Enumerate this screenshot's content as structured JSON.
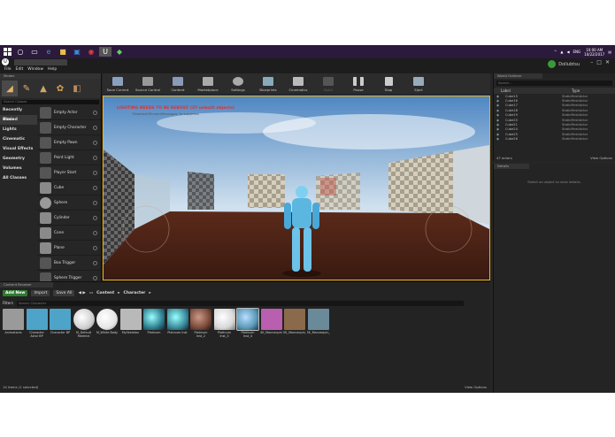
{
  "taskbar": {
    "clock_time": "10:00 AM",
    "clock_date": "10/22/2017",
    "lang": "ENG"
  },
  "ue": {
    "menu": [
      "File",
      "Edit",
      "Window",
      "Help"
    ],
    "user_name": "Dollubtsu"
  },
  "modes": {
    "tab_label": "Modes",
    "search_placeholder": "Search Classes",
    "categories": [
      "Recently Placed",
      "Basic",
      "Lights",
      "Cinematic",
      "Visual Effects",
      "Geometry",
      "Volumes",
      "All Classes"
    ],
    "active_category": "Basic",
    "items": [
      "Empty Actor",
      "Empty Character",
      "Empty Pawn",
      "Point Light",
      "Player Start",
      "Cube",
      "Sphere",
      "Cylinder",
      "Cone",
      "Plane",
      "Box Trigger",
      "Sphere Trigger"
    ]
  },
  "toolbar": {
    "buttons": [
      "Save Current",
      "Source Control",
      "Content",
      "Marketplace",
      "Settings",
      "Blueprints",
      "Cinematics",
      "Build",
      "Pause",
      "Stop",
      "Eject"
    ]
  },
  "viewport": {
    "warning": "LIGHTING NEEDS TO BE REBUILT (37 unbuilt objects)",
    "warning_sub": "'DisableAllScreenMessages' to suppress"
  },
  "content_browser": {
    "tab_label": "Content Browser",
    "add_new": "Add New",
    "import": "Import",
    "save_all": "Save All",
    "path": [
      "Content",
      "Character"
    ],
    "filters": "Filters",
    "search_placeholder": "Search Character",
    "assets": [
      {
        "name": "Animations",
        "color": "#9a9a9a"
      },
      {
        "name": "Character Actor BP",
        "color": "#4ea3c8"
      },
      {
        "name": "Character BP",
        "color": "#4ea3c8"
      },
      {
        "name": "M_Default Material",
        "color": "#cfcfcf"
      },
      {
        "name": "M_White Body",
        "color": "#e5e5e5"
      },
      {
        "name": "MySkeleton",
        "color": "#b9b9b9"
      },
      {
        "name": "Platinum",
        "color": "#2f7f8f"
      },
      {
        "name": "Platinum Inst",
        "color": "#3a8a9a"
      },
      {
        "name": "Platinum Inst_2",
        "color": "#7a4a3a"
      },
      {
        "name": "Platinum Inst_3",
        "color": "#d8d8d8"
      },
      {
        "name": "Platinum Inst_4",
        "color": "#5a9ab8"
      },
      {
        "name": "SK_Mannequin",
        "color": "#b85fb0"
      },
      {
        "name": "SK_Mannequin_PhysicsAsset",
        "color": "#8a6a4a"
      },
      {
        "name": "SK_Mannequin_Skeleton",
        "color": "#6a8a9a"
      }
    ],
    "footer_left": "14 items (1 selected)",
    "footer_right": "View Options"
  },
  "outliner": {
    "tab_label": "World Outliner",
    "search_placeholder": "Search...",
    "col_label": "Label",
    "col_type": "Type",
    "rows": [
      {
        "label": "Cube15",
        "type": "StaticMeshActor"
      },
      {
        "label": "Cube16",
        "type": "StaticMeshActor"
      },
      {
        "label": "Cube17",
        "type": "StaticMeshActor"
      },
      {
        "label": "Cube18",
        "type": "StaticMeshActor"
      },
      {
        "label": "Cube19",
        "type": "StaticMeshActor"
      },
      {
        "label": "Cube20",
        "type": "StaticMeshActor"
      },
      {
        "label": "Cube21",
        "type": "StaticMeshActor"
      },
      {
        "label": "Cube24",
        "type": "StaticMeshActor"
      },
      {
        "label": "Cube25",
        "type": "StaticMeshActor"
      },
      {
        "label": "Cube26",
        "type": "StaticMeshActor"
      }
    ],
    "actor_count": "47 actors",
    "view_options": "View Options"
  },
  "details": {
    "tab_label": "Details",
    "empty_msg": "Select an object to view details."
  }
}
